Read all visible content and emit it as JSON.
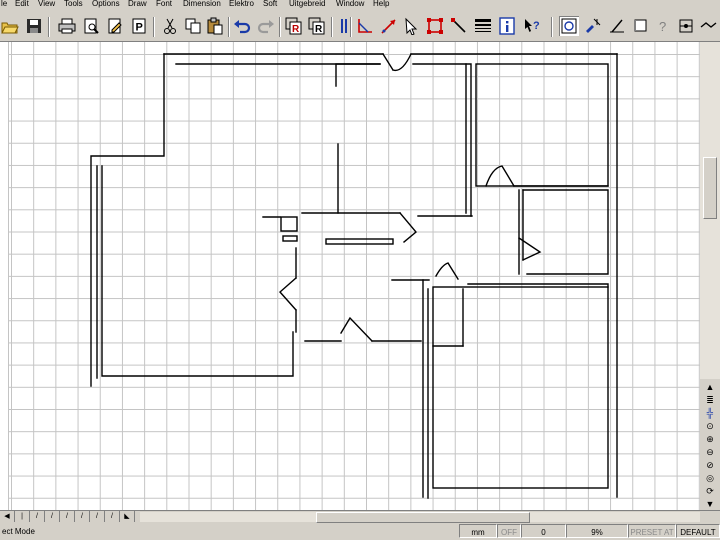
{
  "menu": [
    "le",
    "Edit",
    "View",
    "Tools",
    "Options",
    "Draw",
    "Font",
    "Dimension",
    "Elektro",
    "Soft",
    "Uitgebreid",
    "Window",
    "Help"
  ],
  "toolbar_icons": [
    "open-folder-icon",
    "save-icon",
    "print-icon",
    "print-preview-icon",
    "page-p-icon",
    "cut-icon",
    "copy-icon",
    "paste-icon",
    "undo-icon",
    "redo-icon",
    "object-r-icon",
    "object-r2-icon",
    "parallel-icon",
    "red-angle-icon",
    "red-arrow-icon",
    "red-square-icon",
    "red-pointer-icon",
    "lines-icon",
    "info-icon",
    "help-pointer-icon",
    "zoom-window-icon",
    "zoom-pointer-icon",
    "rectangle-icon",
    "question-icon",
    "snap-icon",
    "draw-line-icon"
  ],
  "side_tools": [
    "arrow-up-icon",
    "layers-icon",
    "plus-icon",
    "search-icon",
    "zoom-in-icon",
    "zoom-out-icon",
    "zoom-fit-icon",
    "target-icon",
    "refresh-icon",
    "arrow-down-icon"
  ],
  "page_tabs": [
    "◀",
    "|",
    "/",
    "/",
    "/",
    "/",
    "/",
    "/",
    "◣"
  ],
  "status": {
    "mode": "ect Mode",
    "units": "mm",
    "toggle": "OFF",
    "value": "0",
    "zoom": "9%",
    "preset": "PRESET AT",
    "layer": "DEFAULT"
  }
}
